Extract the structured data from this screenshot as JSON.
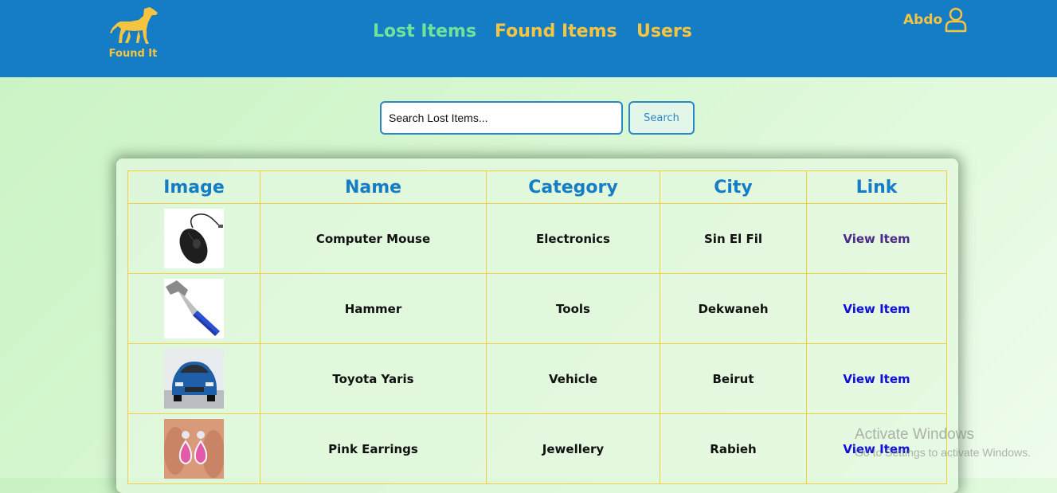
{
  "nav": {
    "logo_text": "Found It",
    "links": [
      "Lost Items",
      "Found Items",
      "Users"
    ],
    "user_name": "Abdo"
  },
  "search": {
    "placeholder": "Search Lost Items...",
    "button_label": "Search"
  },
  "table": {
    "headers": [
      "Image",
      "Name",
      "Category",
      "City",
      "Link"
    ],
    "rows": [
      {
        "image": "computer-mouse-image",
        "name": "Computer Mouse",
        "category": "Electronics",
        "city": "Sin El Fil",
        "link": "View Item"
      },
      {
        "image": "hammer-image",
        "name": "Hammer",
        "category": "Tools",
        "city": "Dekwaneh",
        "link": "View Item"
      },
      {
        "image": "toyota-yaris-image",
        "name": "Toyota Yaris",
        "category": "Vehicle",
        "city": "Beirut",
        "link": "View Item"
      },
      {
        "image": "pink-earrings-image",
        "name": "Pink Earrings",
        "category": "Jewellery",
        "city": "Rabieh",
        "link": "View Item"
      }
    ]
  },
  "watermark": {
    "title": "Activate Windows",
    "subtitle": "Go to Settings to activate Windows."
  },
  "colors": {
    "navbar": "#157dc5",
    "accent_yellow": "#f5c542",
    "active_link": "#6fe39a",
    "table_border": "#f2cf42"
  }
}
